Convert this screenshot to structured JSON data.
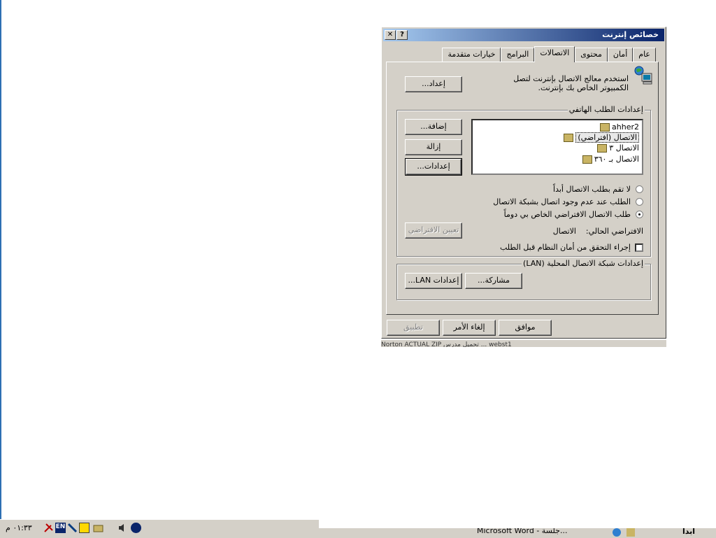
{
  "dialog": {
    "title": "خصائص إنترنت",
    "help_btn": "?",
    "close_btn": "✕",
    "tabs": [
      "عام",
      "أمان",
      "محتوى",
      "الاتصالات",
      "البرامج",
      "خيارات متقدمة"
    ],
    "setup_text": "استخدم معالج الاتصال بإنترنت لتصل الكمبيوتر الخاص بك بإنترنت.",
    "setup_button": "إعداد...",
    "dialup": {
      "group_label": "إعدادات الطلب الهاتفي",
      "connections": [
        "ahher2",
        "الاتصال (افتراضي)",
        "الاتصال ٣",
        "الاتصال بـ ٣٦٠"
      ],
      "add_button": "إضافة...",
      "remove_button": "إزالة",
      "settings_button": "إعدادات...",
      "radio_never": "لا تقم بطلب الاتصال أبداً",
      "radio_when_none": "الطلب عند عدم وجود اتصال بشبكة الاتصال",
      "radio_always": "طلب الاتصال الافتراضي الخاص بي دوماً",
      "current_default_label": "الافتراضي الحالي:",
      "current_default_value": "الاتصال",
      "set_default_button": "تعيين الافتراضي",
      "security_check": "إجراء التحقق من أمان النظام قبل الطلب"
    },
    "lan": {
      "group_label": "إعدادات شبكة الاتصال المحلية (LAN)",
      "lan_settings_button": "إعدادات LAN...",
      "sharing_button": "مشاركة..."
    },
    "ok_button": "موافق",
    "cancel_button": "إلغاء الأمر",
    "apply_button": "تطبيق"
  },
  "taskbar": {
    "clock": "٠١:٣٣ م",
    "lang": "EN",
    "window_button": "Microsoft Word - جلسة...",
    "start": "ابدأ",
    "bg_items": "Norton   ACTUAL ZIP   تحميل   مدرس   ...   webst1"
  }
}
